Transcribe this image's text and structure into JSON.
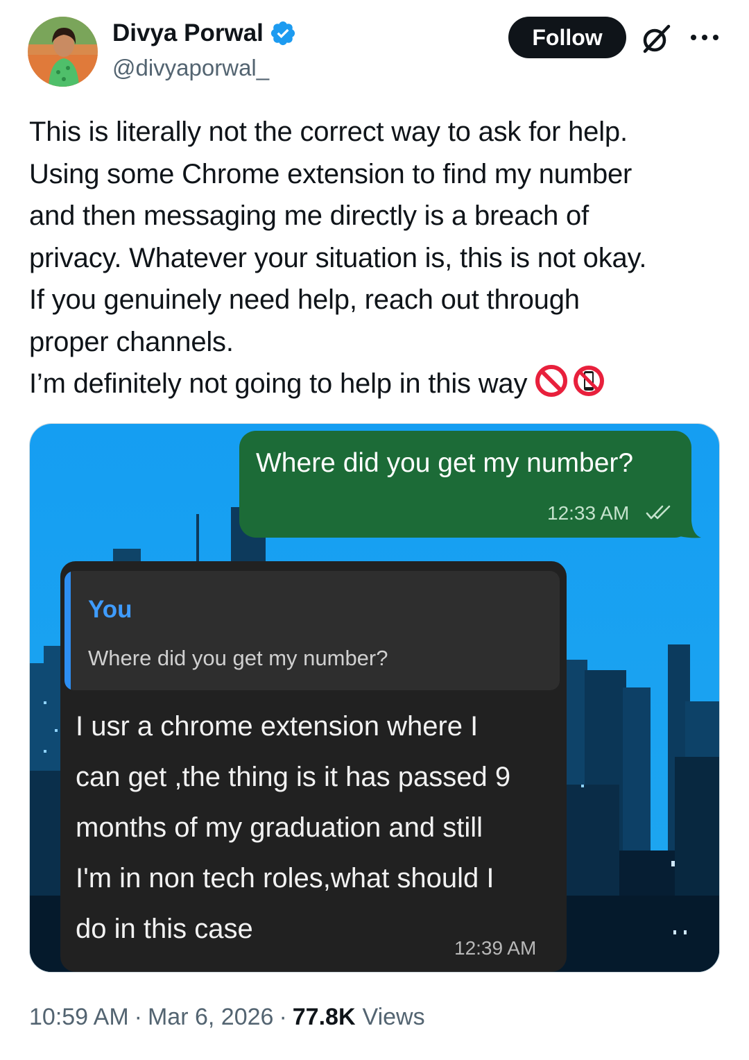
{
  "author": {
    "display_name": "Divya Porwal",
    "handle": "@divyaporwal_",
    "verified": true
  },
  "actions": {
    "follow_label": "Follow"
  },
  "tweet": {
    "lines": [
      "This is literally not the correct way to ask for help.",
      "Using some Chrome extension to find my number",
      "and then messaging me directly is a breach of",
      "privacy. Whatever your situation is, this is not okay.",
      "If you genuinely need help, reach out through",
      "proper channels.",
      "I’m definitely not going to help in this way"
    ],
    "trailing_emojis": [
      "prohibited-emoji",
      "no-mobile-phones-emoji"
    ]
  },
  "media": {
    "outgoing_message": {
      "text": "Where did you get my number?",
      "time": "12:33 AM"
    },
    "incoming_message": {
      "quote_author": "You",
      "quote_text": "Where did you get my number?",
      "lines": [
        "I usr a chrome extension where I",
        "can get ,the thing is it has passed 9",
        "months of my graduation and still",
        "I'm in non tech roles,what should I",
        "do in this case"
      ],
      "time": "12:39 AM"
    }
  },
  "meta": {
    "time": "10:59 AM",
    "date": "Mar 6, 2026",
    "views_count": "77.8K",
    "views_label": "Views"
  },
  "colors": {
    "x_blue": "#1d9bf0",
    "sky": "#1aa3f2",
    "outgoing_bubble": "#1c6b37",
    "incoming_bubble": "#212121",
    "quote_accent": "#2d8ef2"
  }
}
